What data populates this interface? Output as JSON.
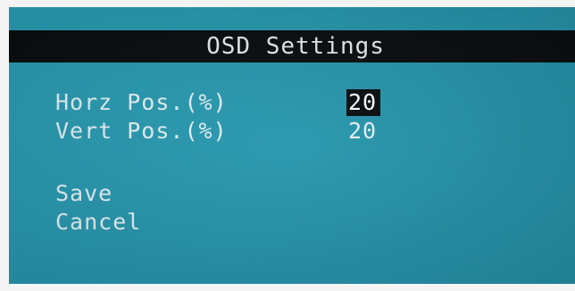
{
  "osd": {
    "title": "OSD Settings",
    "settings": [
      {
        "label": "Horz Pos.(%)",
        "value": "20",
        "selected": true
      },
      {
        "label": "Vert Pos.(%)",
        "value": "20",
        "selected": false
      }
    ],
    "actions": {
      "save_label": "Save",
      "cancel_label": "Cancel"
    }
  },
  "colors": {
    "background": "#2797ae",
    "title_bar": "#0a0d0f",
    "text": "#e6f3f6",
    "highlight": "#0a0d0f"
  }
}
